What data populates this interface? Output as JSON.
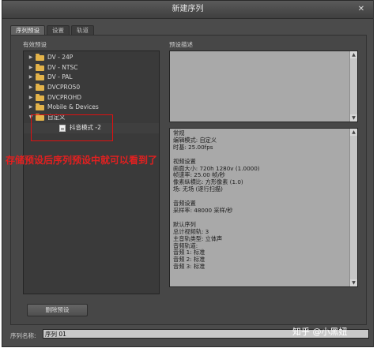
{
  "window": {
    "title": "新建序列",
    "close_symbol": "✕"
  },
  "tabs": [
    {
      "label": "序列预设",
      "active": true
    },
    {
      "label": "设置",
      "active": false
    },
    {
      "label": "轨道",
      "active": false
    }
  ],
  "presets": {
    "label": "有效预设",
    "items": [
      {
        "label": "DV - 24P",
        "expanded": false
      },
      {
        "label": "DV - NTSC",
        "expanded": false
      },
      {
        "label": "DV - PAL",
        "expanded": false
      },
      {
        "label": "DVCPRO50",
        "expanded": false
      },
      {
        "label": "DVCPROHD",
        "expanded": false
      },
      {
        "label": "Mobile & Devices",
        "expanded": false
      },
      {
        "label": "自定义",
        "expanded": true
      }
    ],
    "child_item": {
      "label": "抖音模式 -2",
      "icon": "preset-file-icon"
    },
    "arrow_collapsed": "▶",
    "arrow_expanded": "▼"
  },
  "description": {
    "label": "预设描述",
    "details": [
      "常规",
      "编辑模式: 自定义",
      "时基: 25.00fps",
      "",
      "视频设置",
      "画面大小: 720h 1280v (1.0000)",
      "帧速率: 25.00 帧/秒",
      "像素纵横比: 方形像素 (1.0)",
      "场: 无场 (逐行扫描)",
      "",
      "音频设置",
      "采样率: 48000 采样/秒",
      "",
      "默认序列",
      "总计视频轨: 3",
      "主音轨类型: 立体声",
      "音频轨道:",
      "音频 1: 标准",
      "音频 2: 标准",
      "音频 3: 标准"
    ]
  },
  "delete_button": {
    "label": "删除预设"
  },
  "sequence_name": {
    "label": "序列名称:",
    "value": "序列 01"
  },
  "annotation": {
    "text": "存储预设后序列预设中就可以看到了",
    "color": "#e22020"
  },
  "watermark": {
    "text": "知乎 @小黑妞"
  },
  "scroll_symbols": {
    "up": "▲",
    "down": "▼"
  }
}
